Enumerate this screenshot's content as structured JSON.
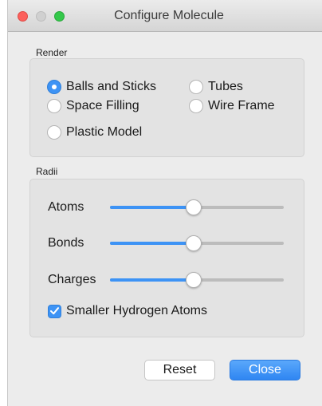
{
  "window": {
    "title": "Configure Molecule"
  },
  "render": {
    "label": "Render",
    "options": [
      {
        "label": "Balls and Sticks",
        "selected": true
      },
      {
        "label": "Tubes",
        "selected": false
      },
      {
        "label": "Space Filling",
        "selected": false
      },
      {
        "label": "Wire Frame",
        "selected": false
      },
      {
        "label": "Plastic Model",
        "selected": false
      }
    ]
  },
  "radii": {
    "label": "Radii",
    "sliders": [
      {
        "label": "Atoms",
        "value": 0.48
      },
      {
        "label": "Bonds",
        "value": 0.48
      },
      {
        "label": "Charges",
        "value": 0.48
      }
    ],
    "smaller_hydrogen": {
      "label": "Smaller Hydrogen Atoms",
      "checked": true
    }
  },
  "buttons": {
    "reset": "Reset",
    "close": "Close"
  },
  "colors": {
    "accent": "#3d93f5",
    "close_red": "#fc605c",
    "zoom_green": "#34c84a"
  }
}
